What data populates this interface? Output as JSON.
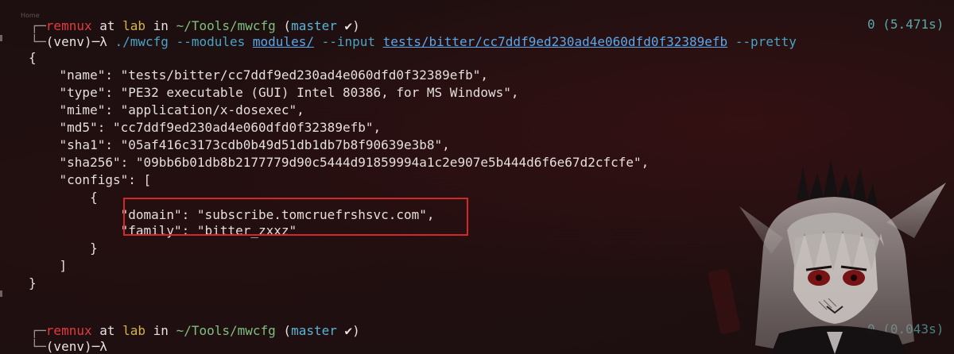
{
  "background_ghost_text": "Home",
  "prompt1": {
    "bar": "┌─",
    "user": "remnux",
    "at": " at ",
    "host": "lab",
    "in": " in ",
    "path": "~/Tools/mwcfg",
    "branch_open": " (",
    "branch": "master",
    "check": " ✔",
    "branch_close": ")"
  },
  "command1": {
    "bar": "└─",
    "venv": "(venv)",
    "lambda": "─λ ",
    "prog": "./mwcfg",
    "arg_modules": " --modules ",
    "modules_value": "modules/",
    "arg_input": " --input ",
    "input_value": "tests/bitter/cc7ddf9ed230ad4e060dfd0f32389efb",
    "arg_pretty": " --pretty",
    "status": "0 (5.471s)"
  },
  "json_output": [
    "{",
    "    \"name\": \"tests/bitter/cc7ddf9ed230ad4e060dfd0f32389efb\",",
    "    \"type\": \"PE32 executable (GUI) Intel 80386, for MS Windows\",",
    "    \"mime\": \"application/x-dosexec\",",
    "    \"md5\": \"cc7ddf9ed230ad4e060dfd0f32389efb\",",
    "    \"sha1\": \"05af416c3173cdb0b49d51db1db7b8f90639e3b8\",",
    "    \"sha256\": \"09bb6b01db8b2177779d90c5444d91859994a1c2e907e5b444d6f6e67d2cfcfe\",",
    "    \"configs\": [",
    "        {",
    "            \"domain\": \"subscribe.tomcruefrshsvc.com\",",
    "            \"family\": \"bitter_zxxz\"",
    "        }",
    "    ]",
    "}"
  ],
  "prompt2": {
    "bar": "┌─",
    "user": "remnux",
    "at": " at ",
    "host": "lab",
    "in": " in ",
    "path": "~/Tools/mwcfg",
    "branch_open": " (",
    "branch": "master",
    "check": " ✔",
    "branch_close": ")"
  },
  "command2": {
    "bar": "└─",
    "venv": "(venv)",
    "lambda": "─λ",
    "status": "0 (0.043s)"
  },
  "colors": {
    "background": "#1d0f10",
    "highlight_border": "#d4272a"
  }
}
